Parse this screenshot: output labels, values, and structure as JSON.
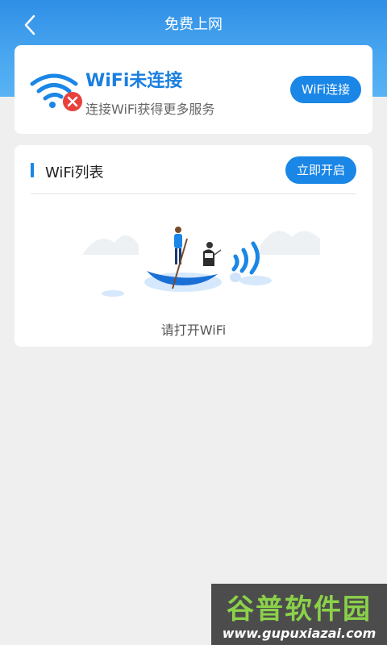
{
  "header": {
    "title": "免费上网",
    "back_icon": "chevron-left-icon"
  },
  "status": {
    "icon": "wifi-disconnected-icon",
    "title": "WiFi未连接",
    "subtitle": "连接WiFi获得更多服务",
    "connect_label": "WiFi连接"
  },
  "wifi_list": {
    "title": "WiFi列表",
    "open_label": "立即开启",
    "empty_text": "请打开WiFi",
    "illustration": "boat-with-people-wifi-illustration"
  },
  "watermark": {
    "title": "谷普软件园",
    "url": "www.gupuxiazai.com"
  },
  "colors": {
    "header_top": "#2f8fe6",
    "accent": "#1a86e6",
    "error": "#e8413c",
    "background": "#efefef"
  }
}
